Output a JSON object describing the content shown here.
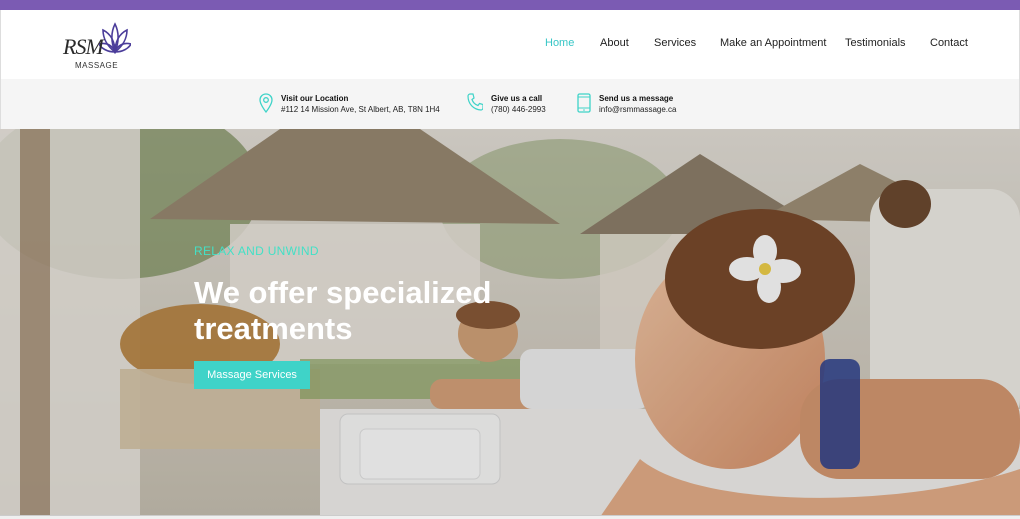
{
  "brand": {
    "logo_text": "RSM",
    "logo_subtext": "MASSAGE"
  },
  "nav": {
    "items": [
      {
        "label": "Home",
        "active": true
      },
      {
        "label": "About",
        "active": false
      },
      {
        "label": "Services",
        "active": false
      },
      {
        "label": "Make an Appointment",
        "active": false
      },
      {
        "label": "Testimonials",
        "active": false
      },
      {
        "label": "Contact",
        "active": false
      }
    ]
  },
  "info": {
    "location": {
      "title": "Visit our Location",
      "value": "#112 14 Mission Ave, St Albert, AB, T8N 1H4",
      "icon": "location-pin-icon"
    },
    "phone": {
      "title": "Give us a call",
      "value": "(780) 446-2993",
      "icon": "phone-icon"
    },
    "message": {
      "title": "Send us a message",
      "value": "info@rsmmassage.ca",
      "icon": "mobile-phone-icon"
    }
  },
  "hero": {
    "tagline": "RELAX AND UNWIND",
    "headline": "We offer specialized treatments",
    "cta_label": "Massage Services"
  },
  "colors": {
    "accent": "#3fd3c8",
    "topbar": "#7b5bb3",
    "tagline": "#43e0c6"
  }
}
